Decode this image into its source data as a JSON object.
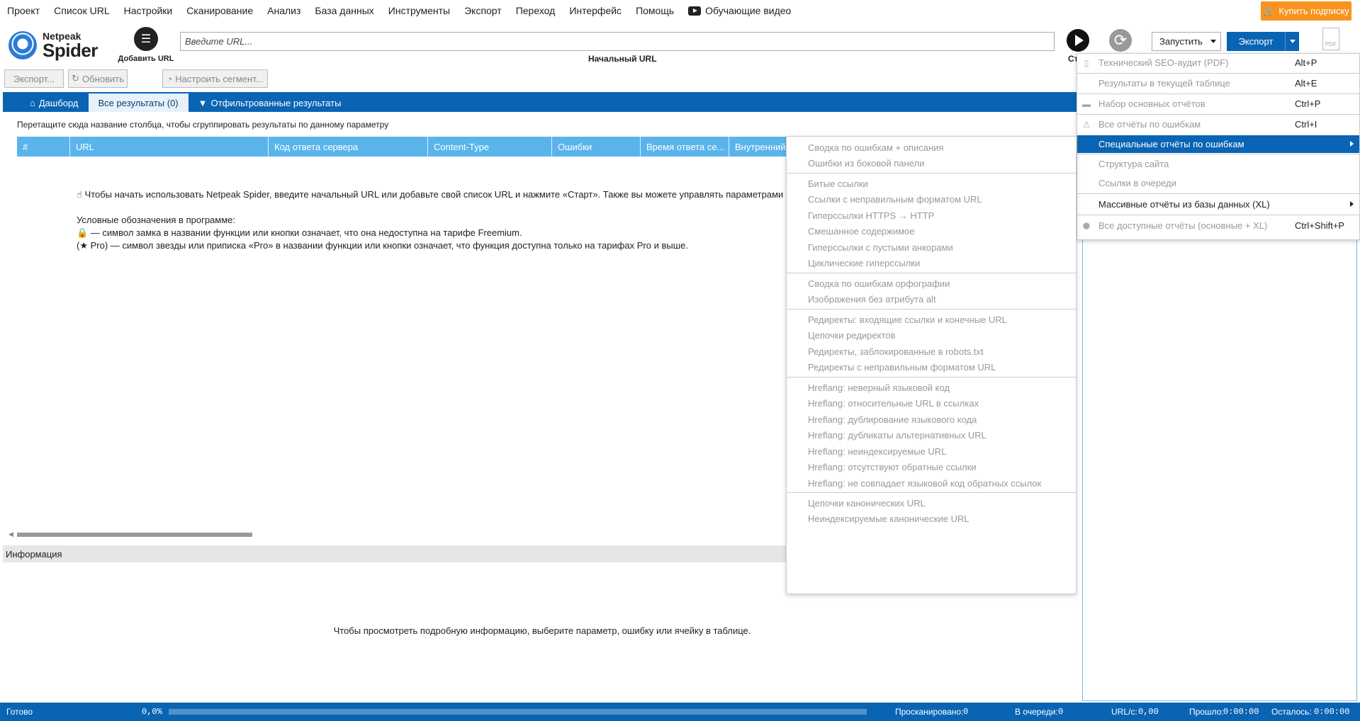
{
  "menubar": {
    "items": [
      "Проект",
      "Список URL",
      "Настройки",
      "Сканирование",
      "Анализ",
      "База данных",
      "Инструменты",
      "Экспорт",
      "Переход",
      "Интерфейс",
      "Помощь"
    ],
    "video_label": "Обучающие видео",
    "buy_label": "Купить подписку",
    "buy_color": "#f7931e"
  },
  "toolbar": {
    "logo_line1": "Netpeak",
    "logo_line2": "Spider",
    "add_url_label": "Добавить URL",
    "url_placeholder": "Введите URL...",
    "url_caption": "Начальный URL",
    "start_caption": "Старт",
    "run_select_value": "Запустить",
    "export_label": "Экспорт",
    "pdf_label": "PDF",
    "accent": "#0a64b4"
  },
  "subtoolbar": {
    "export_btn": "Экспорт...",
    "refresh_btn": "Обновить",
    "segment_btn": "Настроить сегмент..."
  },
  "tabs": [
    {
      "label": "Дашборд",
      "icon": "home-icon"
    },
    {
      "label": "Все результаты (0)",
      "icon": ""
    },
    {
      "label": "Отфильтрованные результаты",
      "icon": "filter-icon"
    }
  ],
  "table": {
    "group_hint": "Перетащите сюда название столбца, чтобы сгруппировать результаты по данному параметру",
    "columns": [
      "#",
      "URL",
      "Код ответа сервера",
      "Content-Type",
      "Ошибки",
      "Время ответа се...",
      "Внутренний"
    ]
  },
  "welcome": {
    "line1": "☝ Чтобы начать использовать Netpeak Spider, введите начальный URL или добавьте свой список URL и нажмите «Старт». Также вы можете управлять параметрами в",
    "legend_title": "Условные обозначения в программе:",
    "lock_line": "🔒 — символ замка в названии функции или кнопки означает, что она недоступна на тарифе Freemium.",
    "star_line": "(★ Pro) — символ звезды или приписка «Pro» в названии функции или кнопки означает, что функция доступна только на тарифах Pro и выше."
  },
  "info_panel": {
    "title": "Информация",
    "message": "Чтобы просмотреть подробную информацию, выберите параметр, ошибку или ячейку в таблице."
  },
  "statusbar": {
    "status": "Готово",
    "progress": "0,0%",
    "scanned_label": "Просканировано:",
    "scanned_value": "0",
    "queue_label": "В очереди:",
    "queue_value": "0",
    "rate_label": "URL/с:",
    "rate_value": "0,00",
    "elapsed_label": "Прошло:",
    "elapsed_value": "0:00:00",
    "remaining_label": "Осталось:",
    "remaining_value": "0:00:00"
  },
  "export_menu": {
    "items": [
      {
        "label": "Технический SEO-аудит (PDF)",
        "shortcut": "Alt+P",
        "icon": "pdf-icon"
      },
      {
        "label": "Результаты в текущей таблице",
        "shortcut": "Alt+E",
        "icon": ""
      },
      {
        "label": "Набор основных отчётов",
        "shortcut": "Ctrl+P",
        "icon": "folder-icon"
      },
      {
        "label": "Все отчёты по ошибкам",
        "shortcut": "Ctrl+I",
        "icon": "warning-icon"
      },
      {
        "label": "Специальные отчёты по ошибкам",
        "shortcut": "",
        "icon": ""
      },
      {
        "label": "Структура сайта",
        "shortcut": "",
        "icon": ""
      },
      {
        "label": "Ссылки в очереди",
        "shortcut": "",
        "icon": ""
      },
      {
        "label": "Массивные отчёты из базы данных (XL)",
        "shortcut": "",
        "icon": ""
      },
      {
        "label": "Все доступные отчёты (основные + XL)",
        "shortcut": "Ctrl+Shift+P",
        "icon": "database-icon"
      }
    ]
  },
  "submenu": {
    "items": [
      "Сводка по ошибкам + описания",
      "Ошибки из боковой панели",
      "Битые ссылки",
      "Ссылки с неправильным форматом URL",
      "Гиперссылки HTTPS → HTTP",
      "Смешанное содержимое",
      "Гиперссылки с пустыми анкорами",
      "Циклические гиперссылки",
      "Сводка по ошибкам орфографии",
      "Изображения без атрибута alt",
      "Редиректы: входящие ссылки и конечные URL",
      "Цепочки редиректов",
      "Редиректы, заблокированные в robots.txt",
      "Редиректы с неправильным форматом URL",
      "Hreflang: неверный языковой код",
      "Hreflang: относительные URL в ссылках",
      "Hreflang: дублирование языкового кода",
      "Hreflang: дубликаты альтернативных URL",
      "Hreflang: неиндексируемые URL",
      "Hreflang: отсутствуют обратные ссылки",
      "Hreflang: не совпадает языковой код обратных ссылок",
      "Цепочки канонических URL",
      "Неиндексируемые канонические URL"
    ]
  }
}
